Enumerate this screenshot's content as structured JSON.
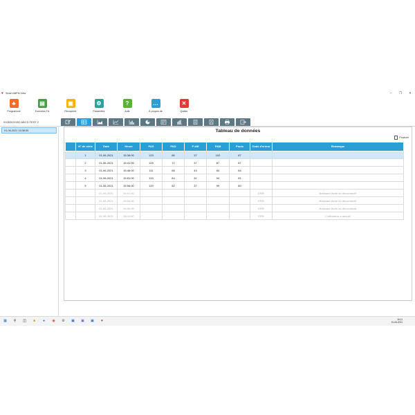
{
  "window": {
    "title": "Smart ABPM View"
  },
  "ribbon": [
    {
      "label": "Programme",
      "color": "#ef6c2e",
      "glyph": "♣"
    },
    {
      "label": "Données TA",
      "color": "#43a047",
      "glyph": "▤"
    },
    {
      "label": "Récupérer",
      "color": "#f5b400",
      "glyph": "▣"
    },
    {
      "label": "Paramètre",
      "color": "#26a69a",
      "glyph": "⚙"
    },
    {
      "label": "Aide",
      "color": "#58b534",
      "glyph": "?"
    },
    {
      "label": "À propos de",
      "color": "#2a9fd6",
      "glyph": "…"
    },
    {
      "label": "Quitter",
      "color": "#e53935",
      "glyph": "✕"
    }
  ],
  "record_title": "01052021000 ABCD TEST 2",
  "sessions": [
    "01-06-2021 15:36:00"
  ],
  "panel": {
    "title": "Tableau de données",
    "posture_label": "Posture"
  },
  "table": {
    "headers": [
      "",
      "N° de série",
      "Date",
      "Heure",
      "PAS",
      "PAD",
      "P diff",
      "PAM",
      "Pouls",
      "Code d'erreur",
      "Remarque"
    ],
    "rows": [
      [
        "",
        "1",
        "01-06-2021",
        "15:36:00",
        "123",
        "86",
        "37",
        "102",
        "87",
        "",
        ""
      ],
      [
        "",
        "2",
        "01-06-2021",
        "15:41:00",
        "109",
        "72",
        "37",
        "87",
        "87",
        "",
        ""
      ],
      [
        "",
        "3",
        "01-06-2021",
        "15:46:00",
        "111",
        "68",
        "43",
        "84",
        "84",
        "",
        ""
      ],
      [
        "",
        "4",
        "01-06-2021",
        "15:51:00",
        "115",
        "84",
        "31",
        "94",
        "81",
        "",
        ""
      ],
      [
        "",
        "5",
        "01-06-2021",
        "15:56:00",
        "119",
        "82",
        "37",
        "99",
        "80",
        "",
        ""
      ],
      [
        "",
        "",
        "01-06-2021",
        "16:01:00",
        "",
        "",
        "",
        "",
        "",
        "ERR",
        "Brassard lâche ou déconnecté"
      ],
      [
        "",
        "",
        "01-06-2021",
        "16:04:00",
        "",
        "",
        "",
        "",
        "",
        "ERR",
        "Brassard lâche ou déconnecté"
      ],
      [
        "",
        "",
        "01-06-2021",
        "16:06:00",
        "",
        "",
        "",
        "",
        "",
        "ERR",
        "Brassard lâche ou déconnecté"
      ],
      [
        "",
        "",
        "01-06-2021",
        "16:11:00",
        "",
        "",
        "",
        "",
        "",
        "ERR",
        "L'utilisateur a annulé"
      ]
    ]
  },
  "taskbar": {
    "time": "16:11",
    "date": "01-06-2021"
  }
}
